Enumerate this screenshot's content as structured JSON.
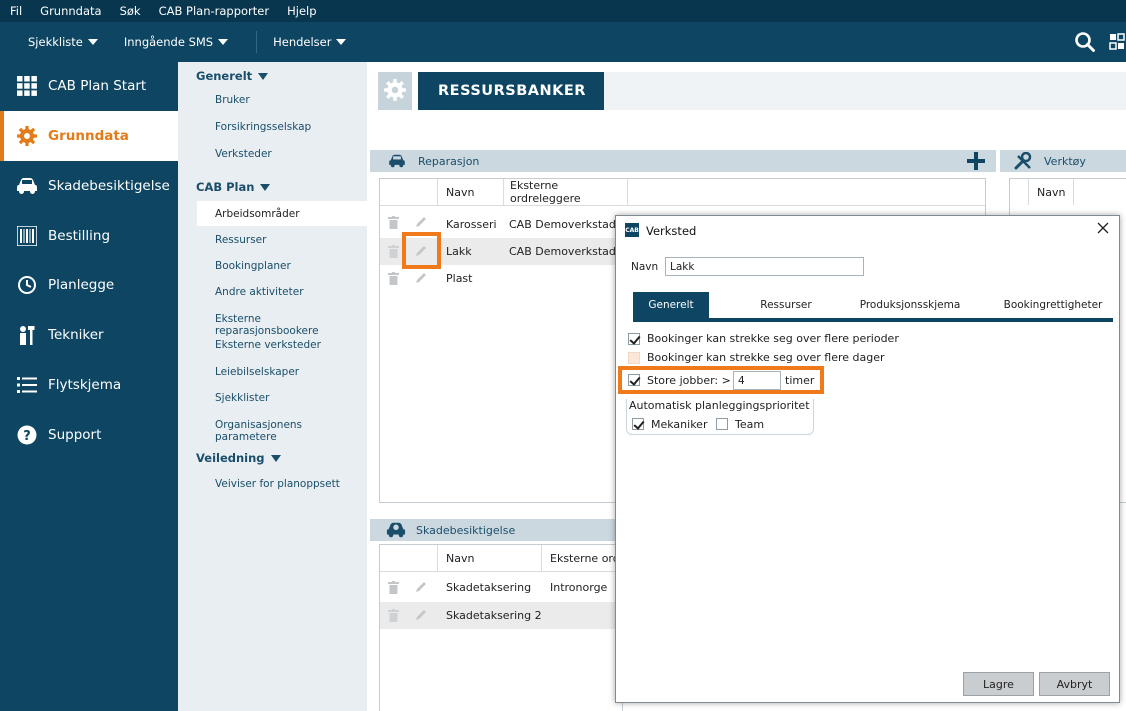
{
  "menubar": {
    "items": [
      "Fil",
      "Grunndata",
      "Søk",
      "CAB Plan-rapporter",
      "Hjelp"
    ]
  },
  "toolbar": {
    "sjekkliste": "Sjekkliste",
    "inngaende_sms": "Inngående SMS",
    "hendelser": "Hendelser"
  },
  "leftnav": {
    "items": [
      {
        "label": "CAB Plan Start",
        "icon": "grid-icon"
      },
      {
        "label": "Grunndata",
        "icon": "gear-icon"
      },
      {
        "label": "Skadebesiktigelse",
        "icon": "car-icon"
      },
      {
        "label": "Bestilling",
        "icon": "barcode-icon"
      },
      {
        "label": "Planlegge",
        "icon": "clock-icon"
      },
      {
        "label": "Tekniker",
        "icon": "mechanic-icon"
      },
      {
        "label": "Flytskjema",
        "icon": "list-icon"
      },
      {
        "label": "Support",
        "icon": "help-icon"
      }
    ]
  },
  "subnav": {
    "generelt": {
      "title": "Generelt",
      "items": [
        "Bruker",
        "Forsikringsselskap",
        "Verksteder"
      ]
    },
    "cabplan": {
      "title": "CAB Plan",
      "items": [
        "Arbeidsområder",
        "Ressurser",
        "Bookingplaner",
        "Andre aktiviteter",
        "Eksterne reparasjonsbookere",
        "Eksterne verksteder",
        "Leiebilselskaper",
        "Sjekklister",
        "Organisasjonens parametere"
      ]
    },
    "veiledning": {
      "title": "Veiledning",
      "items": [
        "Veiviser for planoppsett"
      ]
    }
  },
  "page": {
    "title": "RESSURSBANKER"
  },
  "reparasjon": {
    "title": "Reparasjon",
    "columns": [
      "Navn",
      "Eksterne ordreleggere"
    ],
    "rows": [
      {
        "navn": "Karosseri",
        "ekstern": "CAB Demoverkstad I"
      },
      {
        "navn": "Lakk",
        "ekstern": "CAB Demoverkstad I"
      },
      {
        "navn": "Plast",
        "ekstern": ""
      }
    ]
  },
  "verktoy": {
    "title": "Verktøy",
    "columns": [
      "Navn"
    ]
  },
  "skadebesiktigelse": {
    "title": "Skadebesiktigelse",
    "columns": [
      "Navn",
      "Eksterne ord"
    ],
    "rows": [
      {
        "navn": "Skadetaksering",
        "ekstern": "Intronorge"
      },
      {
        "navn": "Skadetaksering 2",
        "ekstern": ""
      }
    ]
  },
  "dialog": {
    "logo": "CAB",
    "title": "Verksted",
    "navn_label": "Navn",
    "navn_value": "Lakk",
    "tabs": [
      "Generelt",
      "Ressurser",
      "Produksjonsskjema",
      "Bookingrettigheter"
    ],
    "options": {
      "flere_perioder": {
        "label": "Bookinger kan strekke seg over flere perioder",
        "checked": true
      },
      "flere_dager": {
        "label": "Bookinger kan strekke seg over flere dager",
        "checked": false
      },
      "store_jobber": {
        "label": "Store jobber: >",
        "value": "4",
        "unit": "timer",
        "checked": true
      }
    },
    "prioritet": {
      "title": "Automatisk planleggingsprioritet",
      "mekaniker": {
        "label": "Mekaniker",
        "checked": true
      },
      "team": {
        "label": "Team",
        "checked": false
      }
    },
    "buttons": {
      "save": "Lagre",
      "cancel": "Avbryt"
    }
  },
  "colors": {
    "navy": "#0d4562",
    "accent": "#e37b18",
    "highlight": "#f07a1a"
  }
}
